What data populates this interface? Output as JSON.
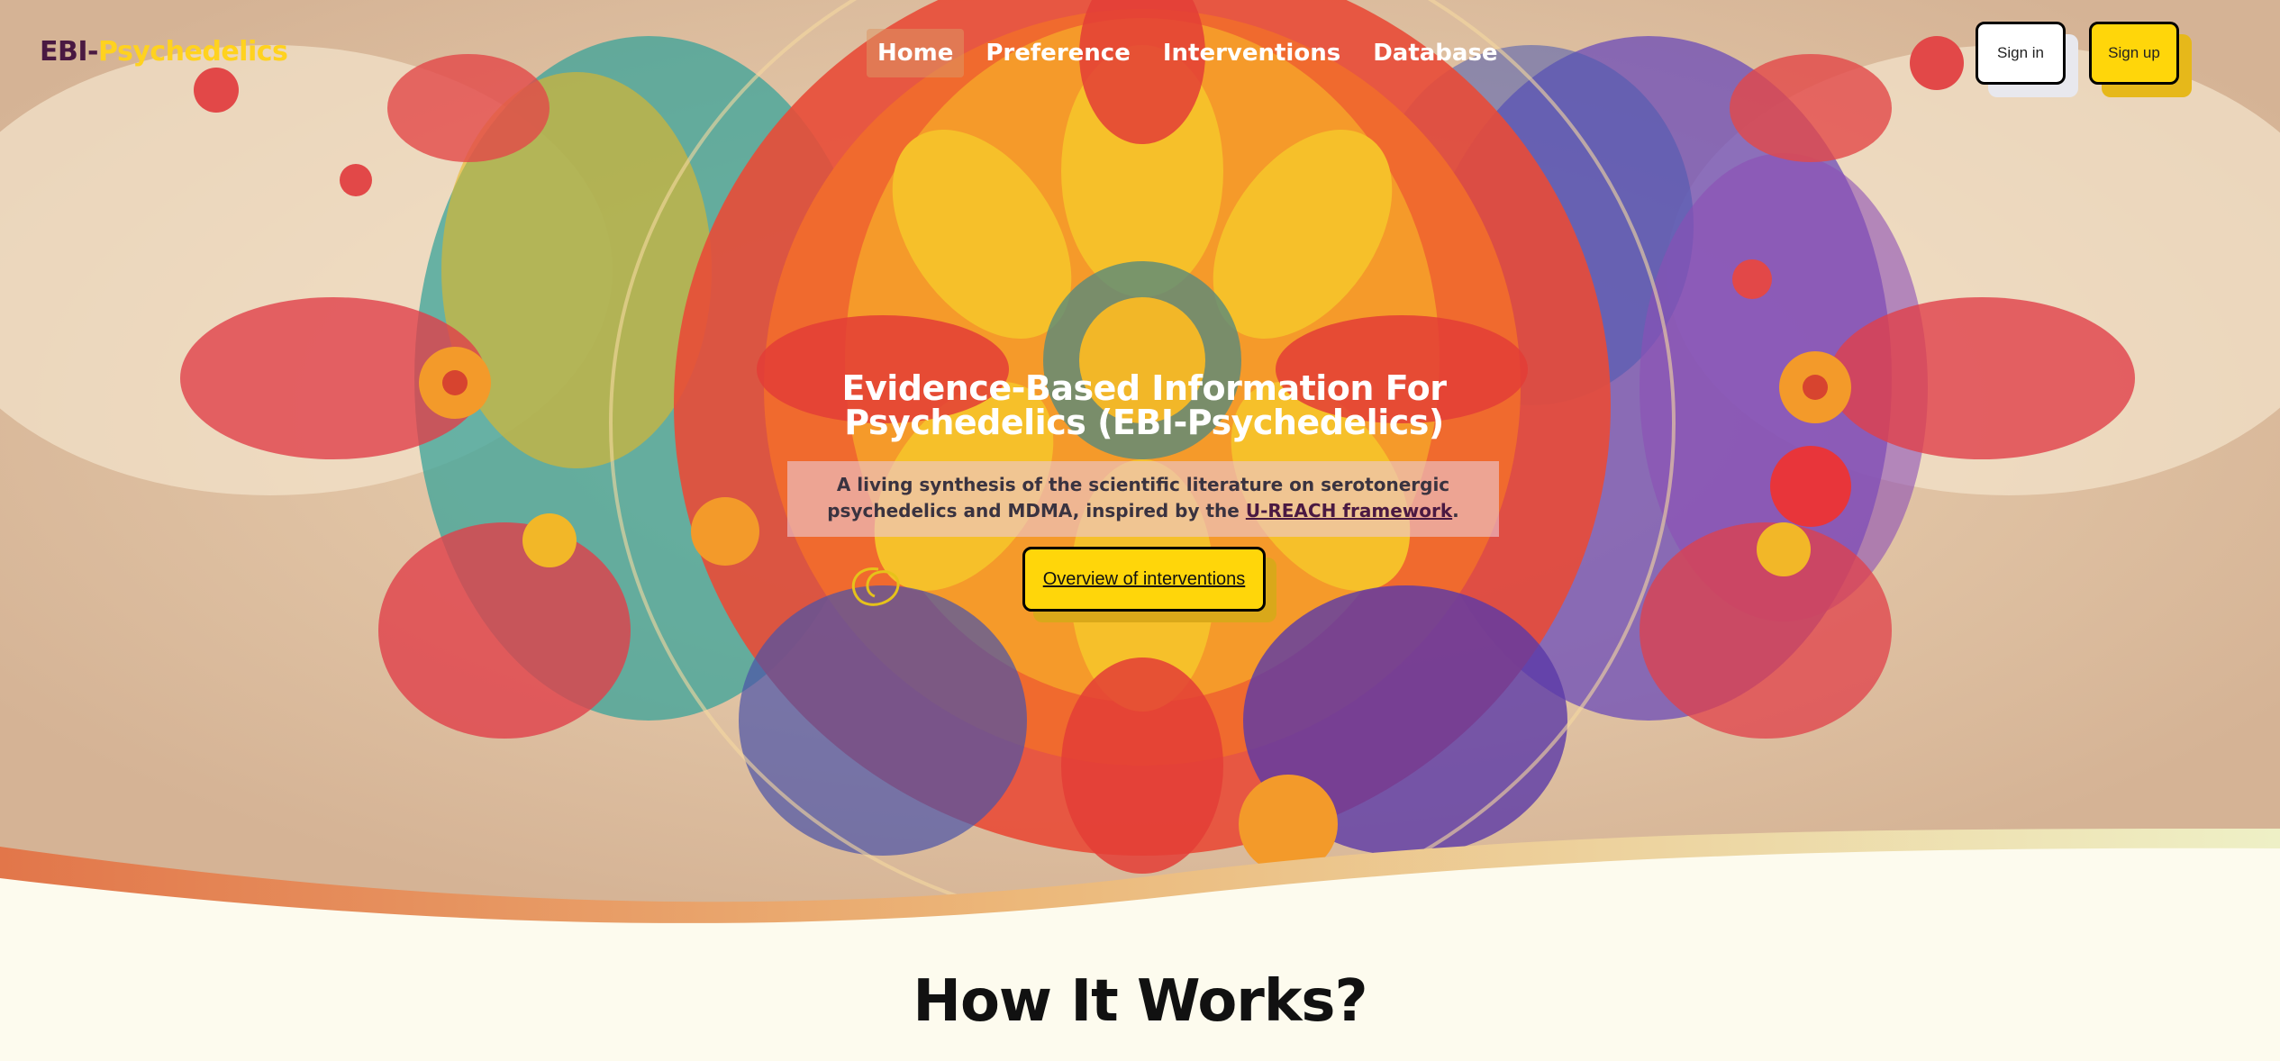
{
  "brand": {
    "part1": "EBI-",
    "part2": "Psychedelics"
  },
  "nav": {
    "items": [
      {
        "label": "Home"
      },
      {
        "label": "Preference"
      },
      {
        "label": "Interventions"
      },
      {
        "label": "Database"
      }
    ],
    "active": "Home"
  },
  "auth": {
    "signin_label": "Sign in",
    "signup_label": "Sign up"
  },
  "hero": {
    "title_line1": "Evidence-Based Information For",
    "title_line2": "Psychedelics (EBI-Psychedelics)",
    "subtitle_before": "A living synthesis of the scientific literature on serotonergic psychedelics and MDMA, inspired by the ",
    "subtitle_link": "U-REACH framework",
    "subtitle_after": ".",
    "cta_label": "Overview of interventions"
  },
  "section": {
    "how_title": "How It Works?"
  },
  "colors": {
    "brand_dark": "#4a1942",
    "brand_yellow": "#ffd21f",
    "button_yellow": "#ffd60a",
    "page_bg": "#fdfbee"
  }
}
